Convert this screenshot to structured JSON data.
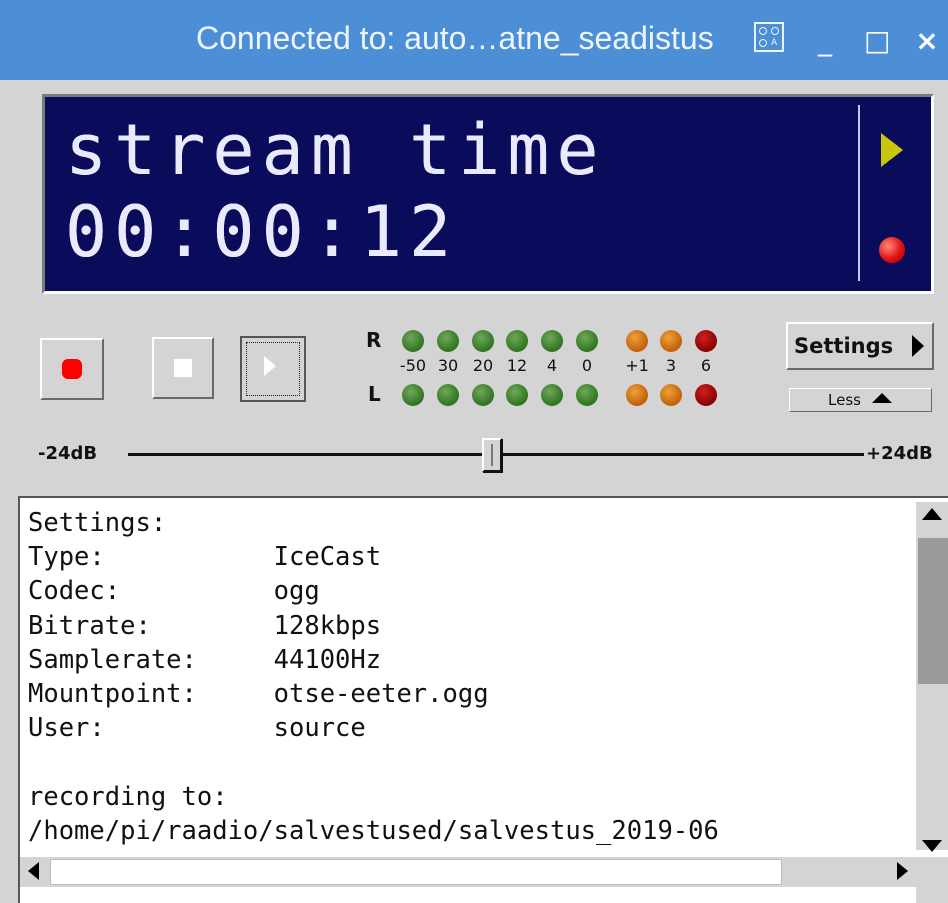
{
  "titlebar": {
    "title": "Connected to: auto…atne_seadistus",
    "app_icon": "raspberry-icon",
    "minimize_glyph": "_",
    "maximize_glyph": "□",
    "close_glyph": "×"
  },
  "display": {
    "line1": "stream time",
    "line2": "00:00:12",
    "play_indicator_color": "#c8c80a",
    "record_indicator_color": "#e01010"
  },
  "controls": {
    "record_icon": "record-icon",
    "stop_icon": "stop-icon",
    "play_icon": "play-icon"
  },
  "vu_meter": {
    "right_label": "R",
    "left_label": "L",
    "scale": [
      "-50",
      "30",
      "20",
      "12",
      "4",
      "0",
      "+1",
      "3",
      "6"
    ],
    "led_colors": [
      "green",
      "green",
      "green",
      "green",
      "green",
      "green",
      "orange",
      "orange",
      "red"
    ]
  },
  "buttons": {
    "settings_label": "Settings",
    "less_label": "Less"
  },
  "volume": {
    "min_label": "-24dB",
    "max_label": "+24dB",
    "level_fraction": 0.5
  },
  "log": {
    "lines": [
      "Settings:",
      "Type:           IceCast",
      "Codec:          ogg",
      "Bitrate:        128kbps",
      "Samplerate:     44100Hz",
      "Mountpoint:     otse-eeter.ogg",
      "User:           source",
      "",
      "recording to:",
      "/home/pi/raadio/salvestused/salvestus_2019-06"
    ]
  },
  "colors": {
    "titlebar": "#4d8fd7",
    "display_bg": "#0b0b5c",
    "window_bg": "#d4d4d4"
  }
}
